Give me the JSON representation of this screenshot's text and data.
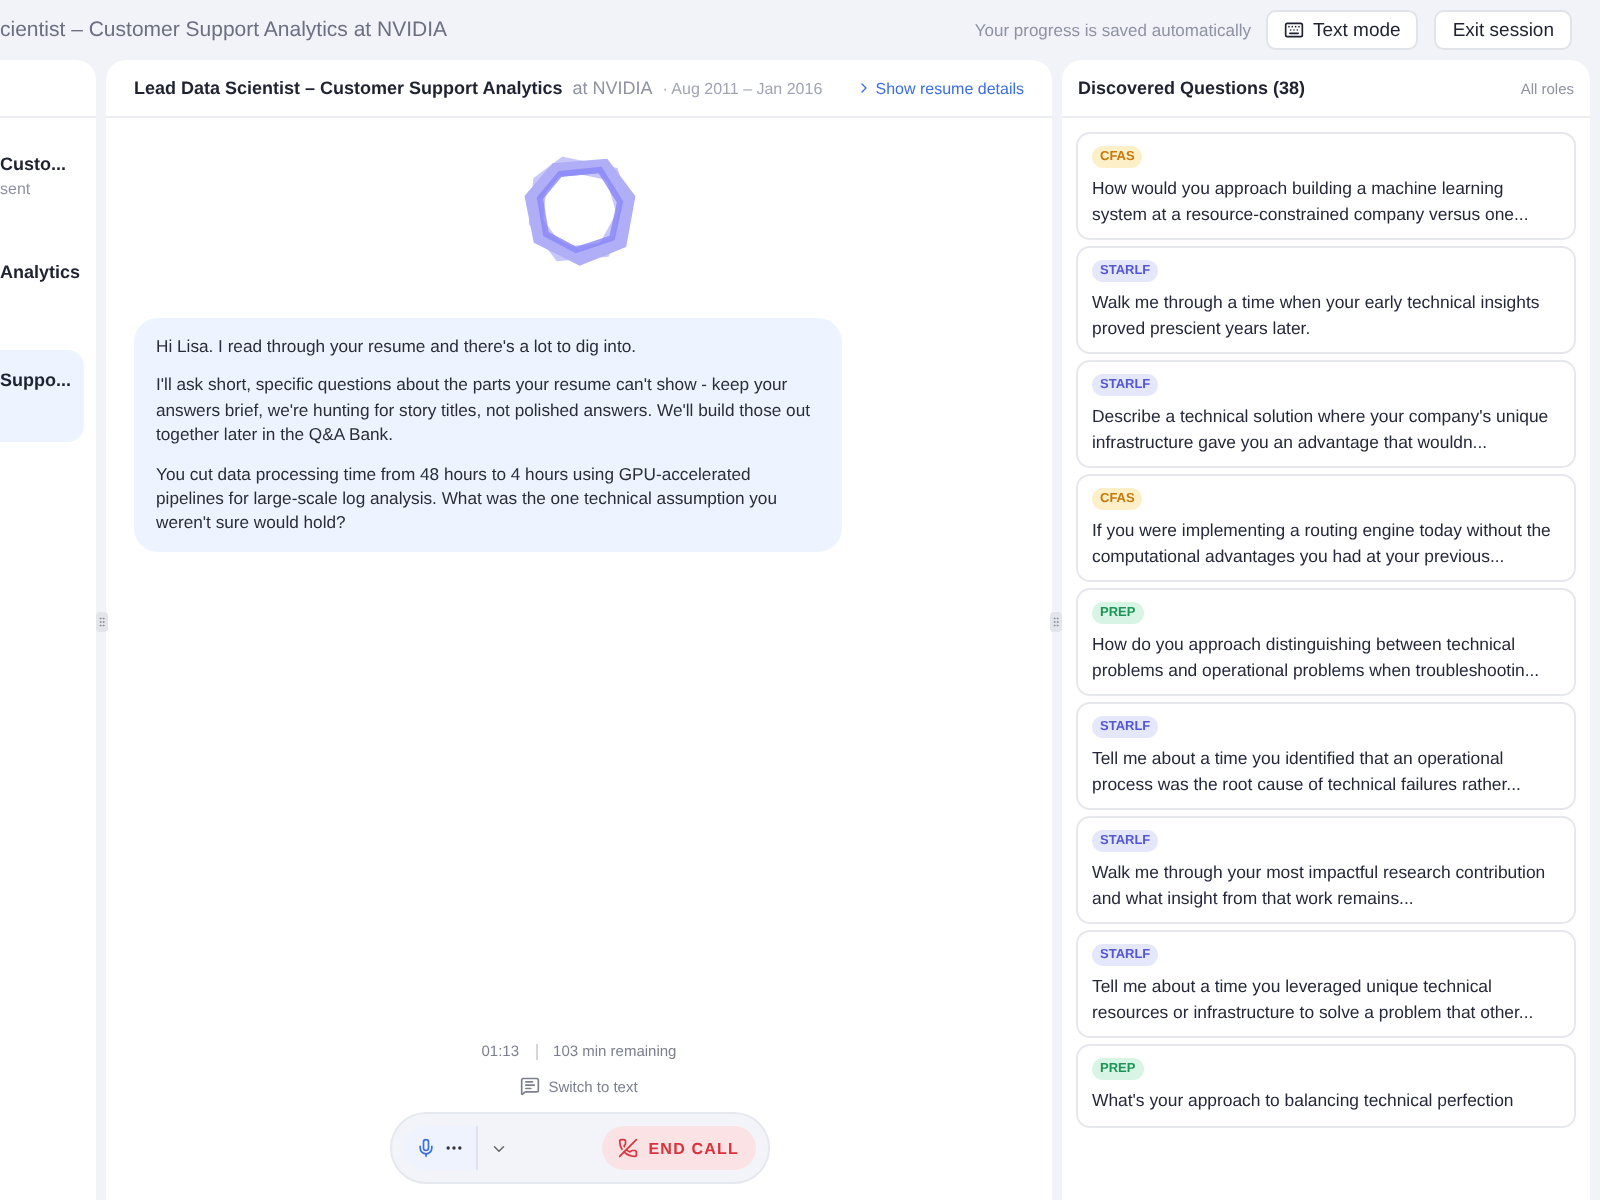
{
  "top_bar": {
    "title": "cientist – Customer Support Analytics at NVIDIA",
    "save_note": "Your progress is saved automatically",
    "buttons": [
      {
        "label": "Text mode",
        "kind": "keyboard"
      },
      {
        "label": "Exit session",
        "kind": "plain"
      }
    ]
  },
  "sidebar": {
    "items": [
      {
        "title": "Custo...",
        "subtitle": "sent",
        "selected": false
      },
      {
        "title": "Analytics",
        "selected": false
      },
      {
        "title": "Suppo...",
        "selected": true
      }
    ]
  },
  "conversation": {
    "role": "Lead Data Scientist – Customer Support Analytics",
    "company": "at NVIDIA",
    "dates": "· Aug 2011 – Jan 2016",
    "details_link": "Show resume details",
    "message": [
      "Hi Lisa. I read through your resume and there's a lot to dig into.",
      "I'll ask short, specific questions about the parts your resume can't show - keep your answers brief, we're hunting for story titles, not polished answers. We'll build those out together later in the Q&A Bank.",
      "You cut data processing time from 48 hours to 4 hours using GPU-accelerated pipelines for large-scale log analysis. What was the one technical assumption you weren't sure would hold?"
    ],
    "timer": "01:13",
    "remaining": "103 min remaining",
    "switch_link": "Switch to text",
    "end_call": "END CALL"
  },
  "questions": {
    "title": "Discovered Questions (38)",
    "filter": "All roles",
    "items": [
      {
        "tag": "CFAS",
        "kind": "cfas",
        "text": "How would you approach building a machine learning system at a resource-constrained company versus one..."
      },
      {
        "tag": "STARLF",
        "kind": "starlf",
        "text": "Walk me through a time when your early technical insights proved prescient years later."
      },
      {
        "tag": "STARLF",
        "kind": "starlf",
        "text": "Describe a technical solution where your company's unique infrastructure gave you an advantage that wouldn..."
      },
      {
        "tag": "CFAS",
        "kind": "cfas",
        "text": "If you were implementing a routing engine today without the computational advantages you had at your previous..."
      },
      {
        "tag": "PREP",
        "kind": "prep",
        "text": "How do you approach distinguishing between technical problems and operational problems when troubleshootin..."
      },
      {
        "tag": "STARLF",
        "kind": "starlf",
        "text": "Tell me about a time you identified that an operational process was the root cause of technical failures rather..."
      },
      {
        "tag": "STARLF",
        "kind": "starlf",
        "text": "Walk me through your most impactful research contribution and what insight from that work remains..."
      },
      {
        "tag": "STARLF",
        "kind": "starlf",
        "text": "Tell me about a time you leveraged unique technical resources or infrastructure to solve a problem that other..."
      },
      {
        "tag": "PREP",
        "kind": "prep",
        "text": "What's your approach to balancing technical perfection"
      }
    ]
  }
}
